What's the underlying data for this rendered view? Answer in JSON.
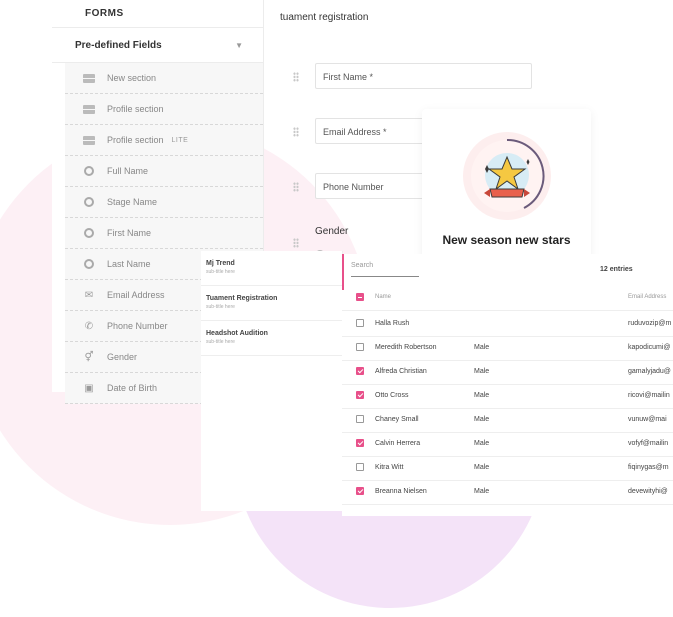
{
  "forms_panel": {
    "header": "FORMS",
    "predefined_label": "Pre-defined Fields",
    "fields": [
      {
        "label": "New section",
        "icon": "section-icon"
      },
      {
        "label": "Profile section",
        "icon": "section-icon"
      },
      {
        "label": "Profile section",
        "icon": "section-icon",
        "badge": "LITE"
      },
      {
        "label": "Full Name",
        "icon": "user-icon"
      },
      {
        "label": "Stage Name",
        "icon": "user-icon"
      },
      {
        "label": "First Name",
        "icon": "user-icon"
      },
      {
        "label": "Last Name",
        "icon": "user-icon"
      },
      {
        "label": "Email Address",
        "icon": "mail-icon"
      },
      {
        "label": "Phone Number",
        "icon": "phone-icon"
      },
      {
        "label": "Gender",
        "icon": "gender-icon"
      },
      {
        "label": "Date of Birth",
        "icon": "calendar-icon"
      }
    ]
  },
  "form": {
    "title": "tuament registration",
    "first_name_placeholder": "First Name *",
    "email_placeholder": "Email Address *",
    "phone_placeholder": "Phone Number",
    "gender_label": "Gender"
  },
  "promo": {
    "title": "New season new stars",
    "icon": "star-trophy-icon"
  },
  "mini_list": [
    {
      "title": "Mj Trend",
      "subtitle": "sub-title here"
    },
    {
      "title": "Tuament Registration",
      "subtitle": "sub-title here"
    },
    {
      "title": "Headshot Audition",
      "subtitle": "sub-title here"
    }
  ],
  "table": {
    "search_placeholder": "Search",
    "entries": "12 entries",
    "headers": {
      "name": "Name",
      "email": "Email Address"
    },
    "rows": [
      {
        "name": "Halla Rush",
        "gender": "",
        "email": "ruduvozip@m",
        "checked": false
      },
      {
        "name": "Meredith Robertson",
        "gender": "Male",
        "email": "kapodicumi@",
        "checked": false
      },
      {
        "name": "Alfreda Christian",
        "gender": "Male",
        "email": "gamalyjadu@",
        "checked": true
      },
      {
        "name": "Otto Cross",
        "gender": "Male",
        "email": "ricovi@mailin",
        "checked": true
      },
      {
        "name": "Chaney Small",
        "gender": "Male",
        "email": "vunuw@mai",
        "checked": false
      },
      {
        "name": "Calvin Herrera",
        "gender": "Male",
        "email": "vofyf@mailin",
        "checked": true
      },
      {
        "name": "Kitra Witt",
        "gender": "Male",
        "email": "fiqinygas@m",
        "checked": false
      },
      {
        "name": "Breanna Nielsen",
        "gender": "Male",
        "email": "devewityhi@",
        "checked": true
      }
    ]
  },
  "colors": {
    "accent": "#e8508a",
    "pink_blob": "#fdf0f5",
    "purple_blob": "#f4e3f8"
  }
}
